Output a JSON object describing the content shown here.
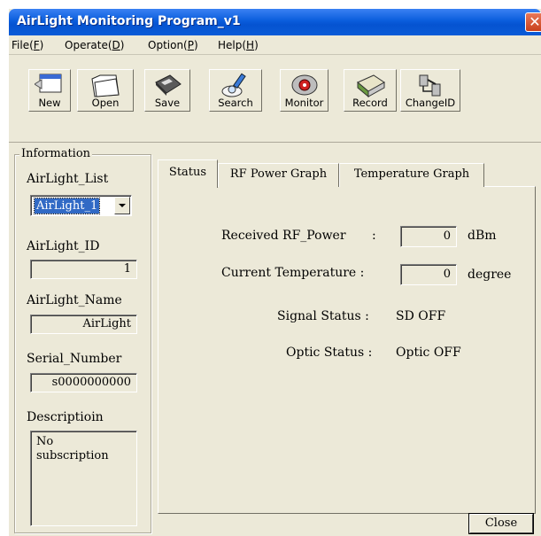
{
  "window": {
    "title": "AirLight Monitoring Program_v1"
  },
  "menu": [
    {
      "label": "File(",
      "key": "F",
      "end": ")"
    },
    {
      "label": "Operate(",
      "key": "D",
      "end": ")"
    },
    {
      "label": "Option(",
      "key": "P",
      "end": ")"
    },
    {
      "label": "Help(",
      "key": "H",
      "end": ")"
    }
  ],
  "toolbar": {
    "new_label": "New",
    "open_label": "Open",
    "save_label": "Save",
    "search_label": "Search",
    "monitor_label": "Monitor",
    "record_label": "Record",
    "changeid_label": "ChangeID"
  },
  "info": {
    "group_label": "Information",
    "list_label": "AirLight_List",
    "list_value": "AirLight_1",
    "id_label": "AirLight_ID",
    "id_value": "1",
    "name_label": "AirLight_Name",
    "name_value": "AirLight",
    "serial_label": "Serial_Number",
    "serial_value": "s0000000000",
    "desc_label": "Descriptioin",
    "desc_value": "No\nsubscription"
  },
  "tabs": [
    {
      "label": "Status"
    },
    {
      "label": "RF Power Graph"
    },
    {
      "label": "Temperature Graph"
    }
  ],
  "status": {
    "rf_label": "Received RF_Power",
    "rf_colon": ":",
    "rf_value": "0",
    "rf_unit": "dBm",
    "temp_label": "Current Temperature :",
    "temp_value": "0",
    "temp_unit": "degree",
    "signal_label": "Signal Status :",
    "signal_value": "SD OFF",
    "optic_label": "Optic Status :",
    "optic_value": "Optic OFF"
  },
  "close_label": "Close",
  "colors": {
    "titlebar": "#0a5ddc",
    "face": "#ece9d8",
    "selection": "#316ac5"
  }
}
